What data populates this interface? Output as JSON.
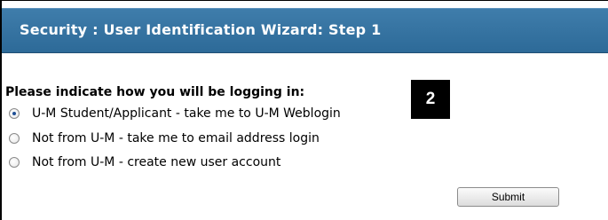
{
  "header": {
    "title": "Security : User Identification Wizard: Step 1"
  },
  "form": {
    "prompt": "Please indicate how you will be logging in:",
    "options": [
      {
        "label": "U-M Student/Applicant - take me to U-M Weblogin",
        "checked": true
      },
      {
        "label": "Not from U-M - take me to email address login",
        "checked": false
      },
      {
        "label": "Not from U-M - create new user account",
        "checked": false
      }
    ],
    "submit_label": "Submit"
  },
  "annotation": {
    "step_number": "2"
  },
  "colors": {
    "title_bar": "#2f6e9e",
    "title_text": "#ffffff",
    "badge_bg": "#000000"
  }
}
